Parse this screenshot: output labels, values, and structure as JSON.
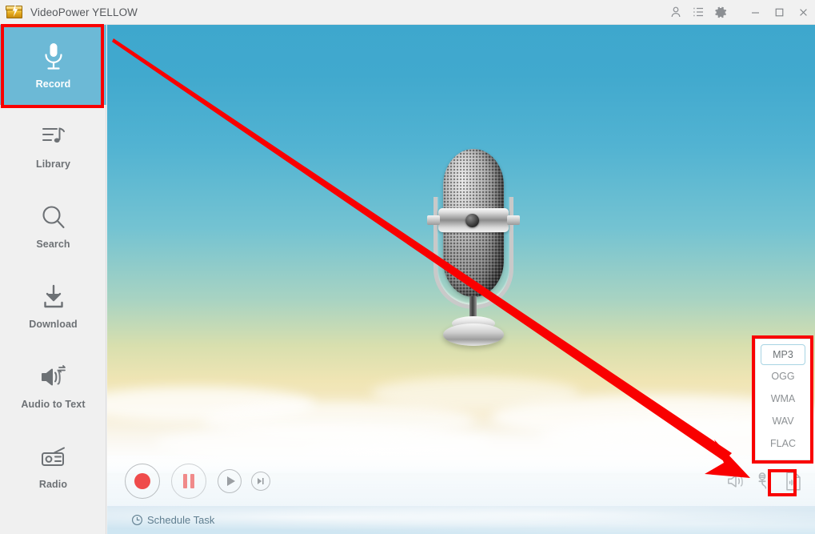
{
  "window": {
    "title": "VideoPower YELLOW",
    "app_icon": "videopower-yellow-logo-icon",
    "titlebar_buttons": [
      {
        "name": "account-icon",
        "label": "Account"
      },
      {
        "name": "list-menu-icon",
        "label": "List"
      },
      {
        "name": "settings-gear-icon",
        "label": "Settings"
      }
    ],
    "window_controls": [
      {
        "name": "minimize-button",
        "label": "Minimize"
      },
      {
        "name": "maximize-button",
        "label": "Maximize"
      },
      {
        "name": "close-button",
        "label": "Close"
      }
    ]
  },
  "sidebar": {
    "items": [
      {
        "label": "Record",
        "icon": "microphone-icon",
        "active": true
      },
      {
        "label": "Library",
        "icon": "library-notes-icon",
        "active": false
      },
      {
        "label": "Search",
        "icon": "magnifier-icon",
        "active": false
      },
      {
        "label": "Download",
        "icon": "download-arrow-icon",
        "active": false
      },
      {
        "label": "Audio to Text",
        "icon": "speaker-convert-icon",
        "active": false
      },
      {
        "label": "Radio",
        "icon": "radio-icon",
        "active": false
      }
    ]
  },
  "stage": {
    "artwork": "vintage-microphone-illustration"
  },
  "controls": {
    "buttons": [
      {
        "name": "record-button",
        "label": "Record"
      },
      {
        "name": "pause-button",
        "label": "Pause"
      },
      {
        "name": "play-button",
        "label": "Play"
      },
      {
        "name": "next-button",
        "label": "Next"
      }
    ],
    "right_icons": [
      {
        "name": "speaker-icon",
        "label": "System Sound"
      },
      {
        "name": "microphone-input-icon",
        "label": "Microphone"
      },
      {
        "name": "audio-format-icon",
        "label": "Output Format"
      }
    ]
  },
  "format_menu": {
    "options": [
      "MP3",
      "OGG",
      "WMA",
      "WAV",
      "FLAC"
    ],
    "selected": "MP3"
  },
  "schedule": {
    "label": "Schedule Task",
    "icon": "clock-icon"
  },
  "annotations": {
    "color": "#f90000",
    "boxes": [
      "record-sidebar-item",
      "format-menu",
      "audio-format-button"
    ],
    "arrow": "points-to-audio-format-button"
  },
  "colors": {
    "accent_teal": "#6cb9d6",
    "titlebar_bg": "#f1f1f1",
    "sidebar_bg": "#f0f0f0",
    "annotation_red": "#f90000",
    "record_dot": "#ef4b4b"
  }
}
